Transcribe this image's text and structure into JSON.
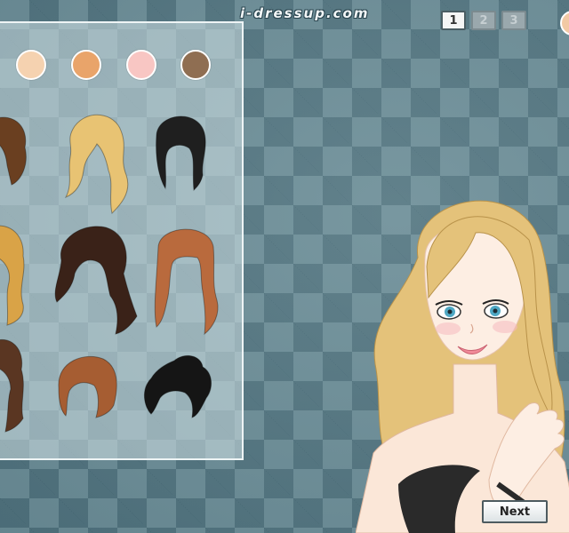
{
  "header": {
    "site_name": "i-dressup.com"
  },
  "pager": {
    "pages": [
      "1",
      "2",
      "3"
    ],
    "active": "1"
  },
  "skin_tones": [
    "#f5d2b0",
    "#e9a46a",
    "#f8c6c3",
    "#8f6e52"
  ],
  "hairstyles": [
    {
      "name": "brown-bob",
      "color": "#6a3f20"
    },
    {
      "name": "blonde-wavy",
      "color": "#e8c373"
    },
    {
      "name": "black-updo",
      "color": "#1f1f1f"
    },
    {
      "name": "honey-wavy",
      "color": "#d9a347"
    },
    {
      "name": "dark-brown-long",
      "color": "#3a2218"
    },
    {
      "name": "auburn-bangs",
      "color": "#b96a3d"
    },
    {
      "name": "brown-waves",
      "color": "#5a3622"
    },
    {
      "name": "copper-bob",
      "color": "#a65d32"
    },
    {
      "name": "black-bun",
      "color": "#151515"
    }
  ],
  "character": {
    "hair_color": "#e4c27a",
    "eye_color": "#4fa8c4",
    "top_color": "#2a2a2a"
  },
  "buttons": {
    "next": "Next"
  }
}
